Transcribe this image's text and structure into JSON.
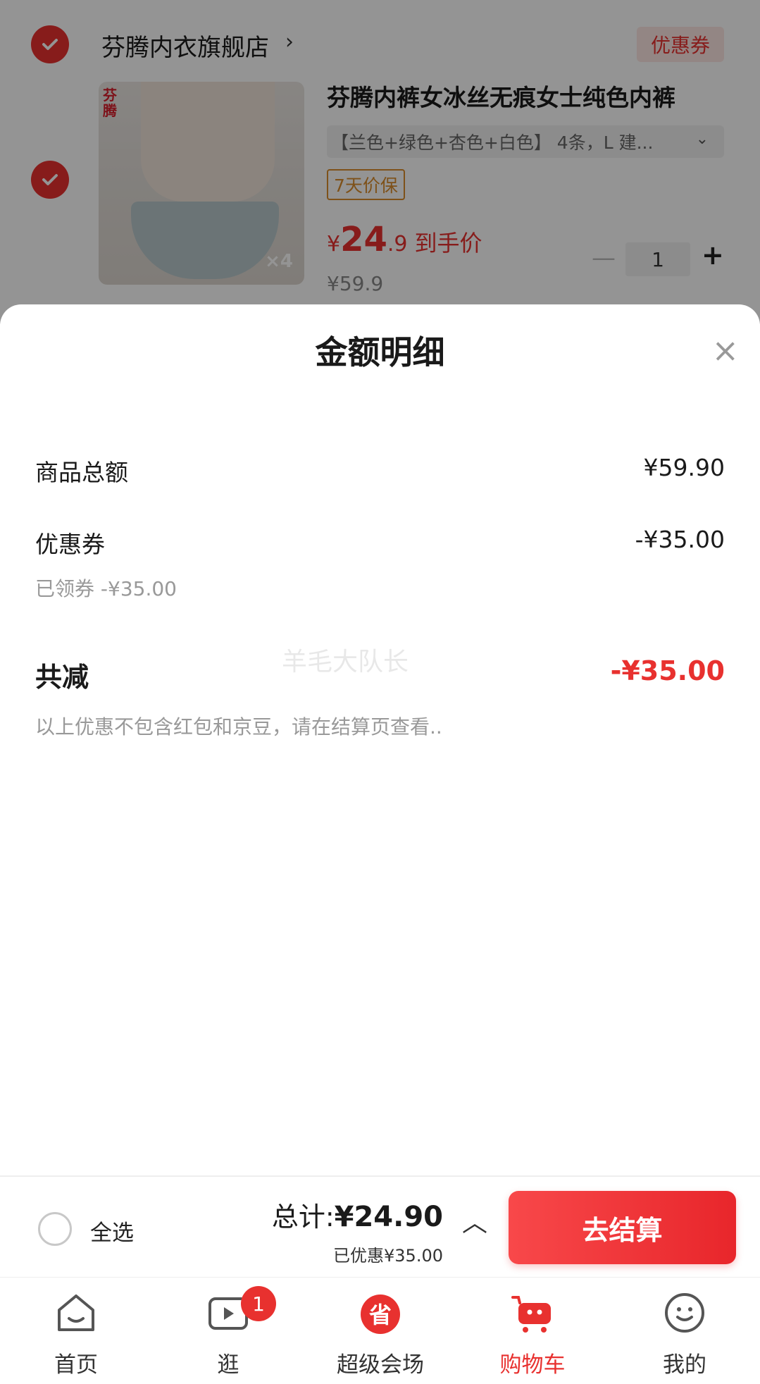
{
  "cart": {
    "store_name": "芬腾内衣旗舰店",
    "store_chevron": "›",
    "coupon_tag": "优惠券",
    "product": {
      "brand_mark": "芬腾",
      "image_badge": "×4",
      "title": "芬腾内裤女冰丝无痕女士纯色内裤",
      "sku": "【兰色+绿色+杏色+白色】 4条，L 建...",
      "sku_chevron": "⌄",
      "price_guard": "7天价保",
      "price_currency": "¥",
      "price_int": "24",
      "price_dec": ".9",
      "price_label": "到手价",
      "original_price": "¥59.9",
      "quantity": "1",
      "qty_minus": "—",
      "qty_plus": "+"
    }
  },
  "sheet": {
    "title": "金额明细",
    "close": "×",
    "goods_total_label": "商品总额",
    "goods_total_value": "¥59.90",
    "coupon_label": "优惠券",
    "coupon_value": "-¥35.00",
    "coupon_sub": "已领券 -¥35.00",
    "total_reduce_label": "共减",
    "total_reduce_value": "-¥35.00",
    "note": "以上优惠不包含红包和京豆，请在结算页查看..",
    "watermark": "羊毛大队长"
  },
  "checkout": {
    "select_all": "全选",
    "total_label": "总计:",
    "total_value": "¥24.90",
    "saved": "已优惠¥35.00",
    "caret": "︿",
    "button": "去结算"
  },
  "tabs": [
    {
      "label": "首页",
      "icon": "home-icon"
    },
    {
      "label": "逛",
      "icon": "video-icon",
      "badge": "1"
    },
    {
      "label": "超级会场",
      "icon": "super-venue-icon"
    },
    {
      "label": "购物车",
      "icon": "cart-icon",
      "active": true
    },
    {
      "label": "我的",
      "icon": "profile-icon"
    }
  ],
  "colors": {
    "accent": "#e8312f",
    "price_guard": "#d98c2b"
  }
}
